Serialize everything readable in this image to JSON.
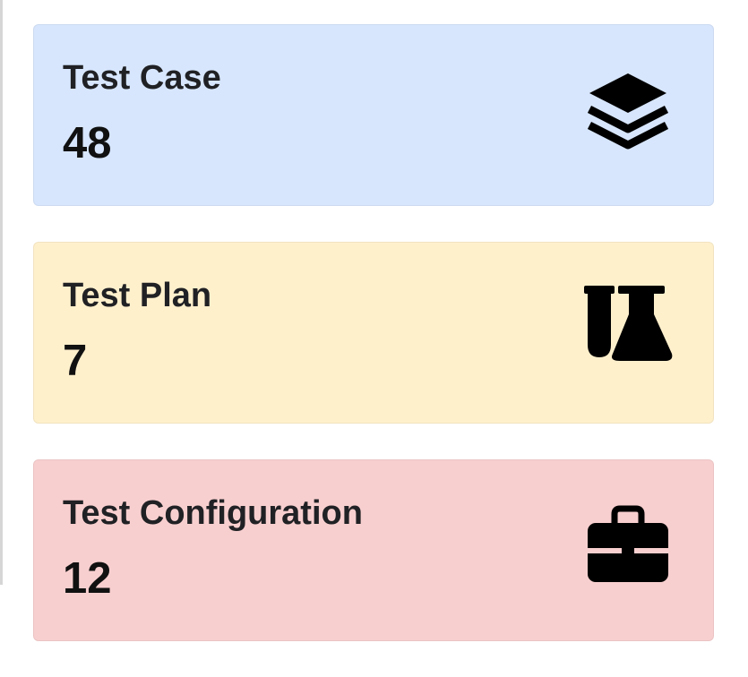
{
  "cards": [
    {
      "title": "Test Case",
      "value": "48",
      "color": "#d7e6fd",
      "icon": "layers-icon"
    },
    {
      "title": "Test Plan",
      "value": "7",
      "color": "#fff0cc",
      "icon": "flask-icon"
    },
    {
      "title": "Test Configuration",
      "value": "12",
      "color": "#f8cfcf",
      "icon": "toolbox-icon"
    }
  ]
}
